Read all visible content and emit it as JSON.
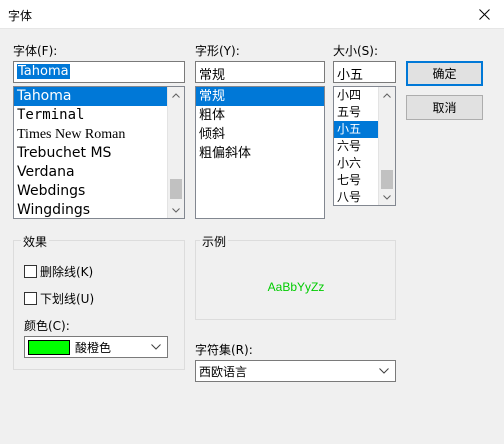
{
  "window": {
    "title": "字体",
    "close_icon": "close-icon"
  },
  "font": {
    "label": "字体(F):",
    "value": "Tahoma",
    "items": [
      "Tahoma",
      "Terminal",
      "Times New Roman",
      "Trebuchet MS",
      "Verdana",
      "Webdings",
      "Wingdings"
    ],
    "selected_index": 0
  },
  "style": {
    "label": "字形(Y):",
    "value": "常规",
    "items": [
      "常规",
      "粗体",
      "倾斜",
      "粗偏斜体"
    ],
    "selected_index": 0
  },
  "size": {
    "label": "大小(S):",
    "value": "小五",
    "items": [
      "小四",
      "五号",
      "小五",
      "六号",
      "小六",
      "七号",
      "八号"
    ],
    "selected_index": 2
  },
  "buttons": {
    "ok": "确定",
    "cancel": "取消"
  },
  "effects": {
    "label": "效果",
    "strikeout_label": "删除线(K)",
    "strikeout_checked": false,
    "underline_label": "下划线(U)",
    "underline_checked": false,
    "color_label": "颜色(C):",
    "color_value": "酸橙色",
    "color_hex": "#00ff00"
  },
  "sample": {
    "label": "示例",
    "text": "AaBbYyZz",
    "color": "#00cc00"
  },
  "charset": {
    "label": "字符集(R):",
    "value": "西欧语言"
  },
  "colors": {
    "selection": "#0078d7",
    "default_button_border": "#0078d7"
  }
}
